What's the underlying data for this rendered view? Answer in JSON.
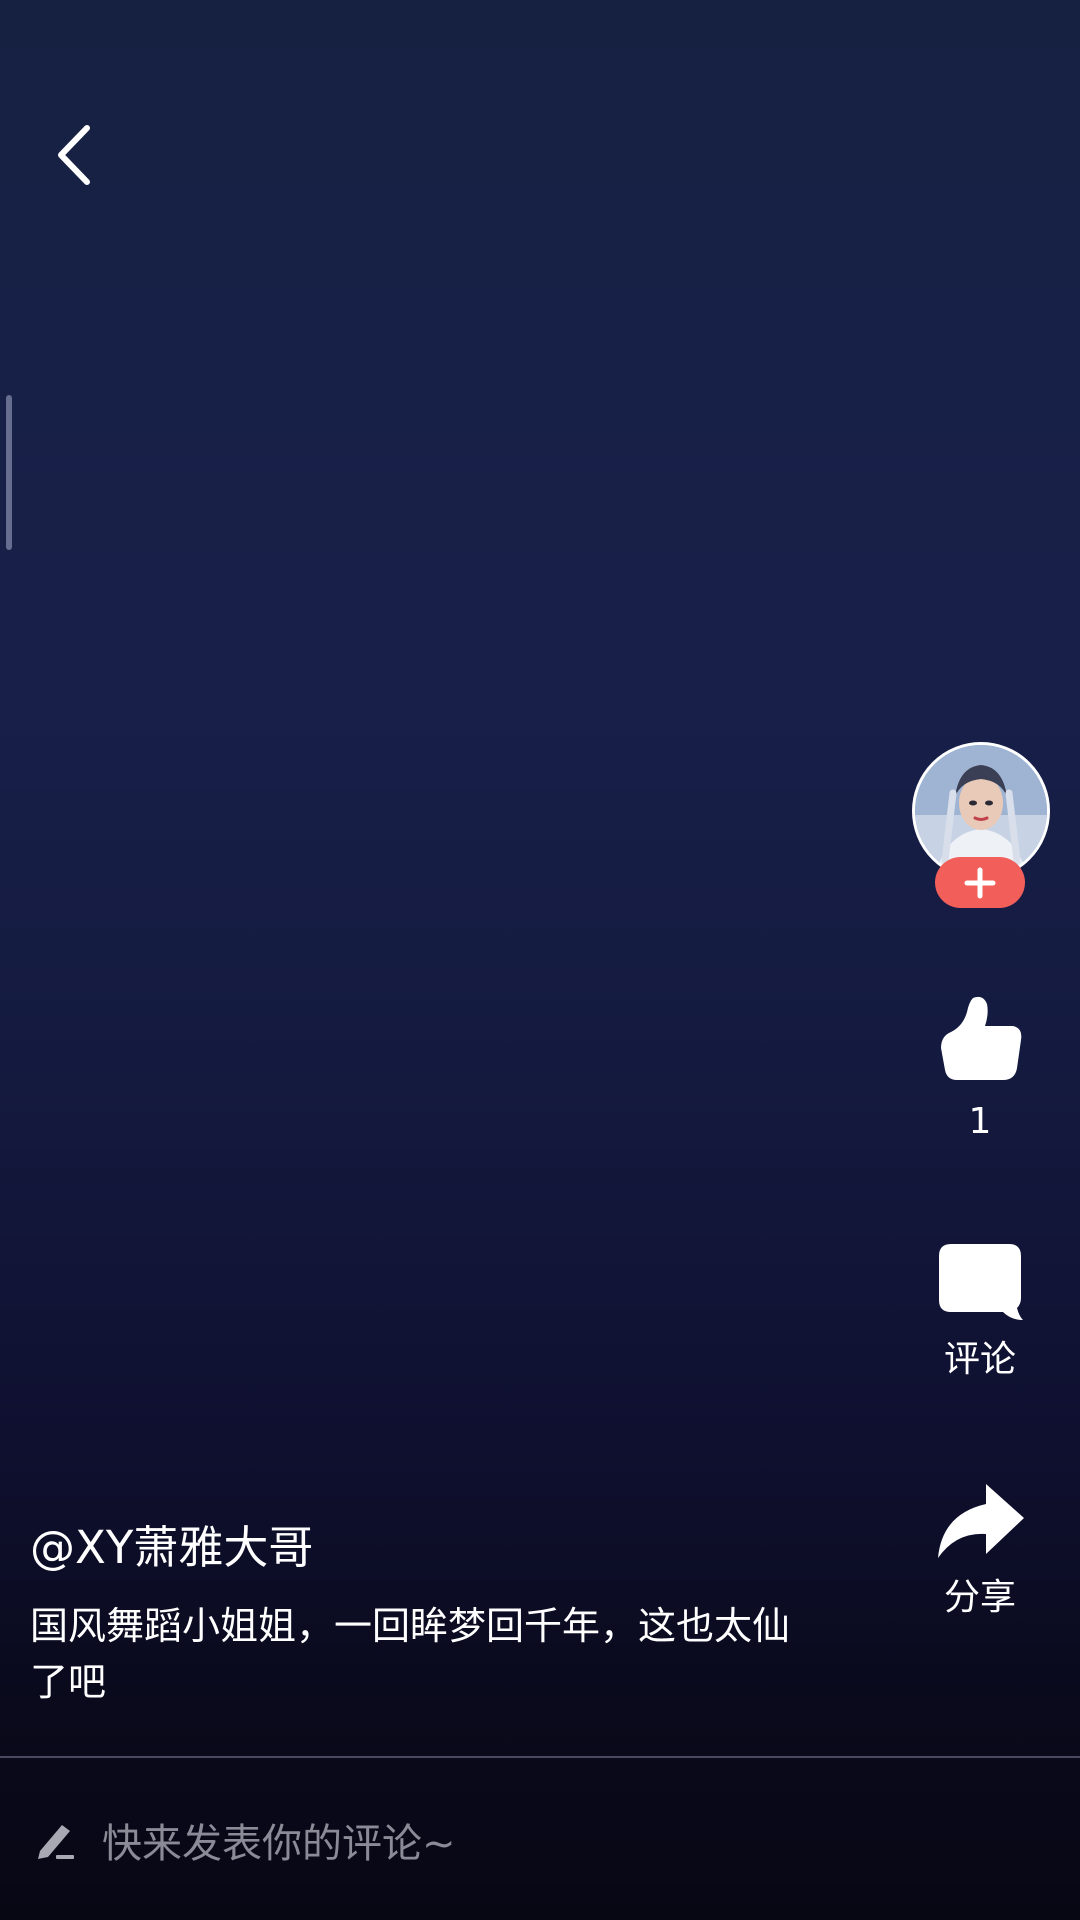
{
  "nav": {
    "back_icon": "chevron-left-icon"
  },
  "author": {
    "handle": "@XY萧雅大哥",
    "avatar_icon": "user-avatar"
  },
  "caption": {
    "text": "国风舞蹈小姐姐，一回眸梦回千年，这也太仙了吧"
  },
  "actions": {
    "follow_icon": "plus-icon",
    "like_count": "1",
    "like_icon": "thumbs-up-icon",
    "comment_label": "评论",
    "comment_icon": "speech-bubble-icon",
    "share_label": "分享",
    "share_icon": "share-arrow-icon"
  },
  "comment_bar": {
    "placeholder": "快来发表你的评论~",
    "icon": "pen-icon"
  },
  "colors": {
    "follow_button": "#f25f5a",
    "background_top": "#162142",
    "background_bottom": "#070714",
    "placeholder_text": "#8a8b96"
  }
}
